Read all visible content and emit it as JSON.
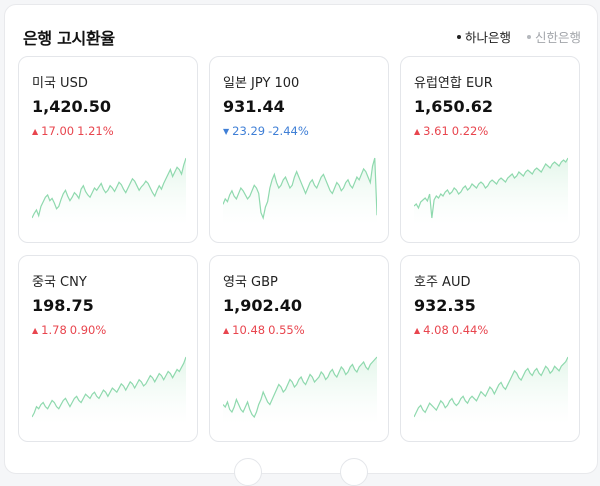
{
  "header": {
    "title": "은행 고시환율",
    "banks": [
      {
        "label": "하나은행",
        "active": true
      },
      {
        "label": "신한은행",
        "active": false
      }
    ]
  },
  "colors": {
    "up": "#e8454e",
    "down": "#3f7fd6",
    "sparkline_line": "#8fd9ae",
    "sparkline_fill": "#e3f6ea"
  },
  "cards": [
    {
      "name": "미국 USD",
      "rate": "1,420.50",
      "change": "17.00",
      "percent": "1.21%",
      "direction": "up",
      "spark": [
        20,
        24,
        27,
        22,
        30,
        34,
        38,
        40,
        35,
        37,
        33,
        28,
        30,
        36,
        41,
        44,
        39,
        35,
        38,
        42,
        40,
        37,
        45,
        48,
        43,
        40,
        38,
        42,
        46,
        44,
        47,
        50,
        45,
        42,
        44,
        48,
        46,
        43,
        47,
        51,
        49,
        45,
        42,
        46,
        50,
        54,
        52,
        48,
        44,
        47,
        49,
        52,
        50,
        46,
        42,
        39,
        44,
        48,
        45,
        50,
        54,
        58,
        62,
        56,
        60,
        64,
        62,
        58,
        66,
        72
      ]
    },
    {
      "name": "일본 JPY 100",
      "rate": "931.44",
      "change": "23.29",
      "percent": "-2.44%",
      "direction": "down",
      "spark": [
        48,
        52,
        50,
        55,
        58,
        54,
        52,
        56,
        60,
        58,
        55,
        52,
        54,
        58,
        62,
        60,
        56,
        42,
        38,
        46,
        50,
        60,
        66,
        70,
        64,
        60,
        62,
        66,
        68,
        64,
        60,
        62,
        68,
        72,
        68,
        64,
        60,
        56,
        60,
        64,
        66,
        62,
        60,
        64,
        68,
        70,
        66,
        62,
        58,
        56,
        60,
        64,
        62,
        58,
        60,
        64,
        66,
        62,
        60,
        64,
        68,
        66,
        70,
        74,
        72,
        68,
        64,
        76,
        82,
        40
      ]
    },
    {
      "name": "유럽연합 EUR",
      "rate": "1,650.62",
      "change": "3.61",
      "percent": "0.22%",
      "direction": "up",
      "spark": [
        40,
        42,
        38,
        44,
        46,
        48,
        45,
        52,
        28,
        46,
        50,
        48,
        52,
        50,
        54,
        56,
        52,
        54,
        58,
        56,
        52,
        54,
        58,
        60,
        56,
        58,
        62,
        60,
        58,
        62,
        64,
        62,
        58,
        60,
        64,
        66,
        64,
        62,
        66,
        68,
        66,
        64,
        68,
        70,
        72,
        68,
        70,
        74,
        72,
        70,
        74,
        76,
        74,
        72,
        76,
        78,
        76,
        74,
        78,
        82,
        80,
        78,
        82,
        84,
        82,
        80,
        84,
        86,
        84,
        88
      ]
    },
    {
      "name": "중국 CNY",
      "rate": "198.75",
      "change": "1.78",
      "percent": "0.90%",
      "direction": "up",
      "spark": [
        20,
        24,
        30,
        28,
        32,
        34,
        30,
        28,
        32,
        36,
        34,
        30,
        28,
        32,
        36,
        38,
        34,
        30,
        34,
        38,
        40,
        36,
        34,
        38,
        42,
        40,
        38,
        42,
        44,
        40,
        38,
        42,
        46,
        44,
        40,
        44,
        48,
        46,
        44,
        48,
        52,
        50,
        46,
        50,
        54,
        52,
        48,
        52,
        56,
        54,
        50,
        52,
        56,
        60,
        58,
        54,
        58,
        62,
        60,
        56,
        60,
        64,
        62,
        58,
        62,
        66,
        64,
        68,
        72,
        78
      ]
    },
    {
      "name": "영국 GBP",
      "rate": "1,902.40",
      "change": "10.48",
      "percent": "0.55%",
      "direction": "up",
      "spark": [
        40,
        38,
        42,
        36,
        34,
        38,
        44,
        40,
        36,
        34,
        38,
        42,
        36,
        32,
        30,
        34,
        40,
        44,
        50,
        46,
        42,
        40,
        44,
        48,
        52,
        56,
        54,
        50,
        52,
        56,
        60,
        58,
        54,
        56,
        60,
        62,
        58,
        56,
        60,
        64,
        62,
        58,
        60,
        62,
        66,
        64,
        60,
        62,
        66,
        68,
        64,
        62,
        66,
        70,
        68,
        64,
        66,
        70,
        72,
        68,
        66,
        70,
        72,
        74,
        70,
        68,
        72,
        74,
        76,
        78
      ]
    },
    {
      "name": "호주 AUD",
      "rate": "932.35",
      "change": "4.08",
      "percent": "0.44%",
      "direction": "up",
      "spark": [
        30,
        34,
        38,
        40,
        36,
        34,
        38,
        42,
        40,
        38,
        36,
        40,
        44,
        42,
        38,
        40,
        44,
        46,
        42,
        40,
        42,
        46,
        48,
        44,
        42,
        46,
        48,
        46,
        44,
        48,
        52,
        50,
        48,
        52,
        56,
        54,
        50,
        54,
        58,
        60,
        56,
        54,
        58,
        62,
        66,
        70,
        68,
        64,
        62,
        66,
        70,
        72,
        68,
        66,
        70,
        72,
        68,
        66,
        70,
        74,
        72,
        68,
        70,
        74,
        72,
        70,
        74,
        76,
        78,
        82
      ]
    }
  ]
}
